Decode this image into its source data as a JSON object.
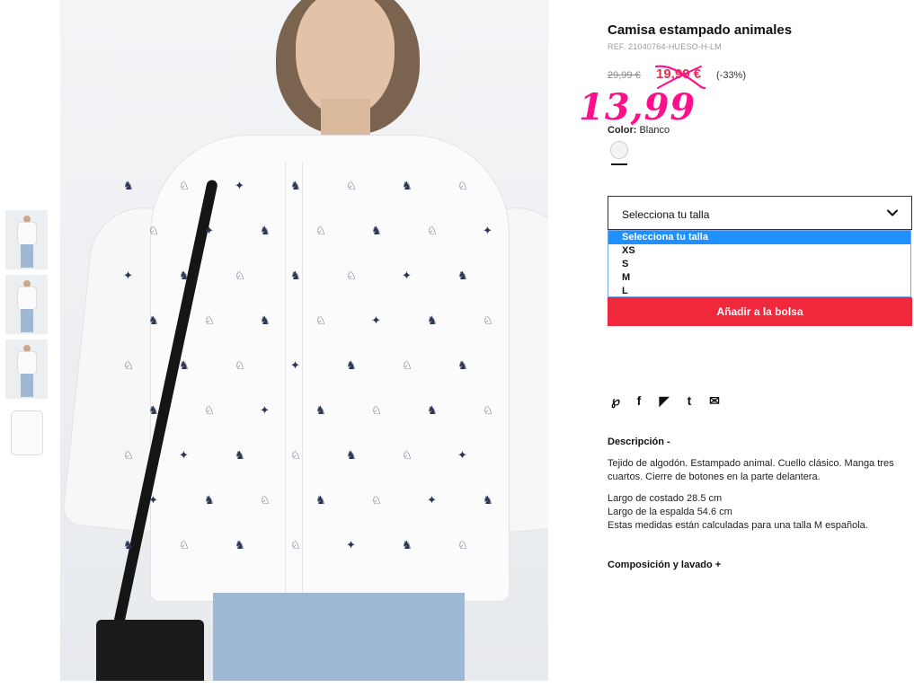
{
  "product": {
    "title": "Camisa estampado animales",
    "ref": "REF. 21040764-HUESO-H-LM",
    "old_price": "29,99 €",
    "sale_price": "19,99 €",
    "discount": "(-33%)",
    "handwritten_price": "13,99",
    "color_label": "Color:",
    "color_value": "Blanco"
  },
  "size_select": {
    "label": "Selecciona tu talla",
    "options": [
      "Selecciona tu talla",
      "XS",
      "S",
      "M",
      "L"
    ],
    "selected_index": 0
  },
  "add_button": {
    "label": "Añadir a la bolsa"
  },
  "share": {
    "icons": [
      "pinterest-icon",
      "facebook-icon",
      "twitter-icon",
      "tumblr-icon",
      "email-icon"
    ],
    "glyphs": [
      "℘",
      "f",
      "◤",
      "t",
      "✉"
    ]
  },
  "description": {
    "heading": "Descripción -",
    "text": "Tejido de algodón. Estampado animal. Cuello clásico. Manga tres cuartos. Cierre de botones en la parte delantera.",
    "measures": [
      "Largo de costado 28.5 cm",
      "Largo de la espalda 54.6 cm",
      "Estas medidas están calculadas para una talla M española."
    ]
  },
  "composition": {
    "heading": "Composición y lavado +"
  },
  "colors": {
    "sale": "#e8304f",
    "button": "#f0283c",
    "handwritten": "#ff0f8a",
    "dropdown_highlight": "#1e90ff"
  }
}
